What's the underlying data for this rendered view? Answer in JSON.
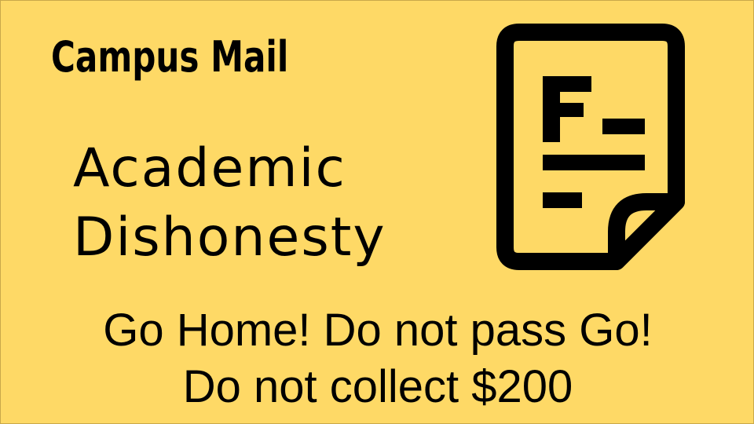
{
  "slide": {
    "header": "Campus Mail",
    "title_line1": "Academic",
    "title_line2": "Dishonesty",
    "subtitle_line1": "Go Home! Do not pass Go!",
    "subtitle_line2": "Do not collect $200"
  },
  "icon": {
    "name": "failing-grade-document-icon",
    "grade": "F"
  },
  "colors": {
    "background": "#FED966",
    "foreground": "#000000"
  }
}
